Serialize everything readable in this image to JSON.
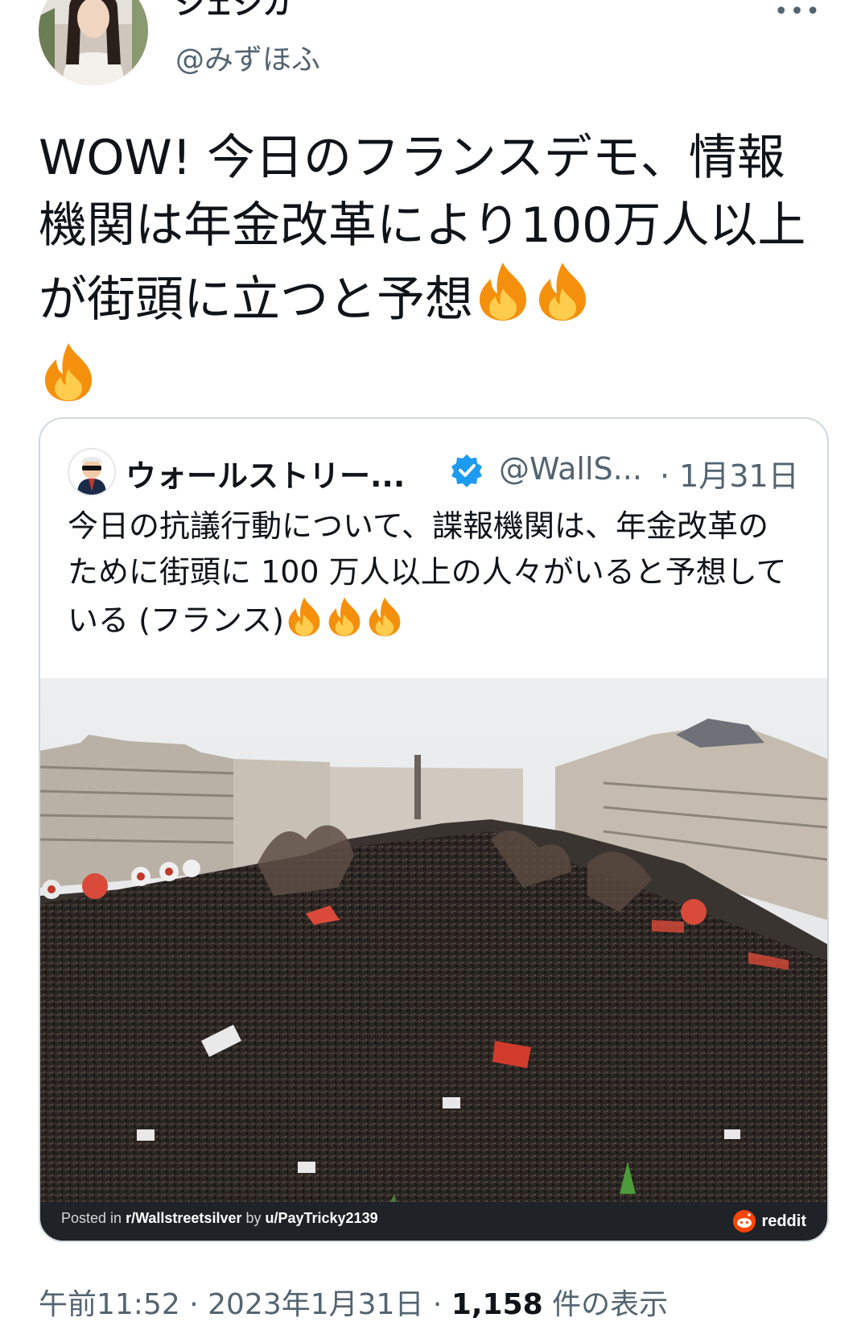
{
  "tweet": {
    "author_name": "ジェジカ",
    "author_handle": "@みずほふ",
    "more_label": "•••",
    "text": "WOW! 今日のフランスデモ、情報機関は年金改革により100万人以上が街頭に立つと予想",
    "emoji": "fire-emoji x3"
  },
  "quoted_tweet": {
    "author_name": "ウォールストリー...",
    "verified": true,
    "handle": "@WallS...",
    "date": "· 1月31日",
    "text": "今日の抗議行動について、諜報機関は、年金改革のために街頭に 100 万人以上の人々がいると予想している (フランス)",
    "image_caption_prefix": "Posted in ",
    "image_caption_sub": "r/Wallstreetsilver",
    "image_caption_by": " by ",
    "image_caption_user": "u/PayTricky2139",
    "image_brand": "reddit"
  },
  "meta": {
    "time": "午前11:52",
    "separator": "·",
    "date": "2023年1月31日",
    "views_count": "1,158",
    "views_label": "件の表示"
  },
  "colors": {
    "text": "#0f1419",
    "secondary": "#536471",
    "border": "#cfd9de",
    "verified_blue": "#1d9bf0",
    "reddit_orange": "#ff4500"
  }
}
